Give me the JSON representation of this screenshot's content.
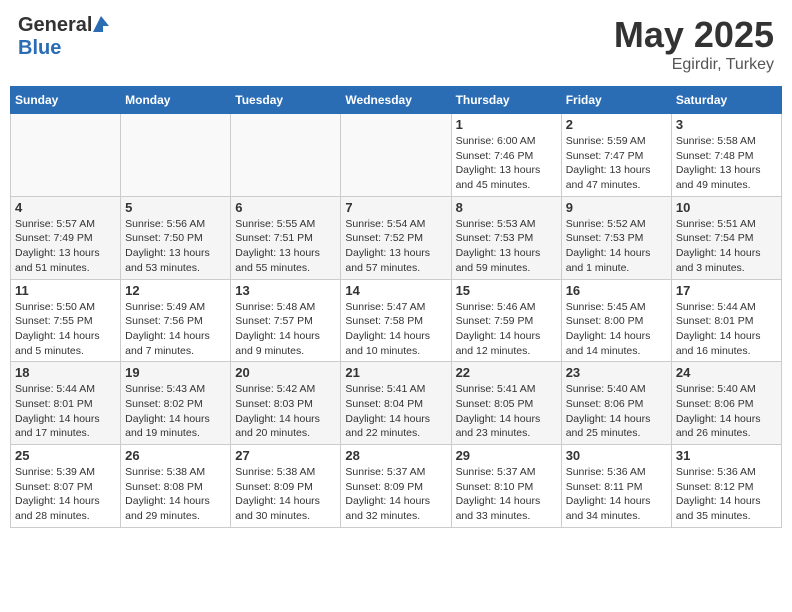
{
  "header": {
    "logo_general": "General",
    "logo_blue": "Blue",
    "title": "May 2025",
    "location": "Egirdir, Turkey"
  },
  "weekdays": [
    "Sunday",
    "Monday",
    "Tuesday",
    "Wednesday",
    "Thursday",
    "Friday",
    "Saturday"
  ],
  "weeks": [
    [
      {
        "day": "",
        "info": ""
      },
      {
        "day": "",
        "info": ""
      },
      {
        "day": "",
        "info": ""
      },
      {
        "day": "",
        "info": ""
      },
      {
        "day": "1",
        "info": "Sunrise: 6:00 AM\nSunset: 7:46 PM\nDaylight: 13 hours\nand 45 minutes."
      },
      {
        "day": "2",
        "info": "Sunrise: 5:59 AM\nSunset: 7:47 PM\nDaylight: 13 hours\nand 47 minutes."
      },
      {
        "day": "3",
        "info": "Sunrise: 5:58 AM\nSunset: 7:48 PM\nDaylight: 13 hours\nand 49 minutes."
      }
    ],
    [
      {
        "day": "4",
        "info": "Sunrise: 5:57 AM\nSunset: 7:49 PM\nDaylight: 13 hours\nand 51 minutes."
      },
      {
        "day": "5",
        "info": "Sunrise: 5:56 AM\nSunset: 7:50 PM\nDaylight: 13 hours\nand 53 minutes."
      },
      {
        "day": "6",
        "info": "Sunrise: 5:55 AM\nSunset: 7:51 PM\nDaylight: 13 hours\nand 55 minutes."
      },
      {
        "day": "7",
        "info": "Sunrise: 5:54 AM\nSunset: 7:52 PM\nDaylight: 13 hours\nand 57 minutes."
      },
      {
        "day": "8",
        "info": "Sunrise: 5:53 AM\nSunset: 7:53 PM\nDaylight: 13 hours\nand 59 minutes."
      },
      {
        "day": "9",
        "info": "Sunrise: 5:52 AM\nSunset: 7:53 PM\nDaylight: 14 hours\nand 1 minute."
      },
      {
        "day": "10",
        "info": "Sunrise: 5:51 AM\nSunset: 7:54 PM\nDaylight: 14 hours\nand 3 minutes."
      }
    ],
    [
      {
        "day": "11",
        "info": "Sunrise: 5:50 AM\nSunset: 7:55 PM\nDaylight: 14 hours\nand 5 minutes."
      },
      {
        "day": "12",
        "info": "Sunrise: 5:49 AM\nSunset: 7:56 PM\nDaylight: 14 hours\nand 7 minutes."
      },
      {
        "day": "13",
        "info": "Sunrise: 5:48 AM\nSunset: 7:57 PM\nDaylight: 14 hours\nand 9 minutes."
      },
      {
        "day": "14",
        "info": "Sunrise: 5:47 AM\nSunset: 7:58 PM\nDaylight: 14 hours\nand 10 minutes."
      },
      {
        "day": "15",
        "info": "Sunrise: 5:46 AM\nSunset: 7:59 PM\nDaylight: 14 hours\nand 12 minutes."
      },
      {
        "day": "16",
        "info": "Sunrise: 5:45 AM\nSunset: 8:00 PM\nDaylight: 14 hours\nand 14 minutes."
      },
      {
        "day": "17",
        "info": "Sunrise: 5:44 AM\nSunset: 8:01 PM\nDaylight: 14 hours\nand 16 minutes."
      }
    ],
    [
      {
        "day": "18",
        "info": "Sunrise: 5:44 AM\nSunset: 8:01 PM\nDaylight: 14 hours\nand 17 minutes."
      },
      {
        "day": "19",
        "info": "Sunrise: 5:43 AM\nSunset: 8:02 PM\nDaylight: 14 hours\nand 19 minutes."
      },
      {
        "day": "20",
        "info": "Sunrise: 5:42 AM\nSunset: 8:03 PM\nDaylight: 14 hours\nand 20 minutes."
      },
      {
        "day": "21",
        "info": "Sunrise: 5:41 AM\nSunset: 8:04 PM\nDaylight: 14 hours\nand 22 minutes."
      },
      {
        "day": "22",
        "info": "Sunrise: 5:41 AM\nSunset: 8:05 PM\nDaylight: 14 hours\nand 23 minutes."
      },
      {
        "day": "23",
        "info": "Sunrise: 5:40 AM\nSunset: 8:06 PM\nDaylight: 14 hours\nand 25 minutes."
      },
      {
        "day": "24",
        "info": "Sunrise: 5:40 AM\nSunset: 8:06 PM\nDaylight: 14 hours\nand 26 minutes."
      }
    ],
    [
      {
        "day": "25",
        "info": "Sunrise: 5:39 AM\nSunset: 8:07 PM\nDaylight: 14 hours\nand 28 minutes."
      },
      {
        "day": "26",
        "info": "Sunrise: 5:38 AM\nSunset: 8:08 PM\nDaylight: 14 hours\nand 29 minutes."
      },
      {
        "day": "27",
        "info": "Sunrise: 5:38 AM\nSunset: 8:09 PM\nDaylight: 14 hours\nand 30 minutes."
      },
      {
        "day": "28",
        "info": "Sunrise: 5:37 AM\nSunset: 8:09 PM\nDaylight: 14 hours\nand 32 minutes."
      },
      {
        "day": "29",
        "info": "Sunrise: 5:37 AM\nSunset: 8:10 PM\nDaylight: 14 hours\nand 33 minutes."
      },
      {
        "day": "30",
        "info": "Sunrise: 5:36 AM\nSunset: 8:11 PM\nDaylight: 14 hours\nand 34 minutes."
      },
      {
        "day": "31",
        "info": "Sunrise: 5:36 AM\nSunset: 8:12 PM\nDaylight: 14 hours\nand 35 minutes."
      }
    ]
  ]
}
